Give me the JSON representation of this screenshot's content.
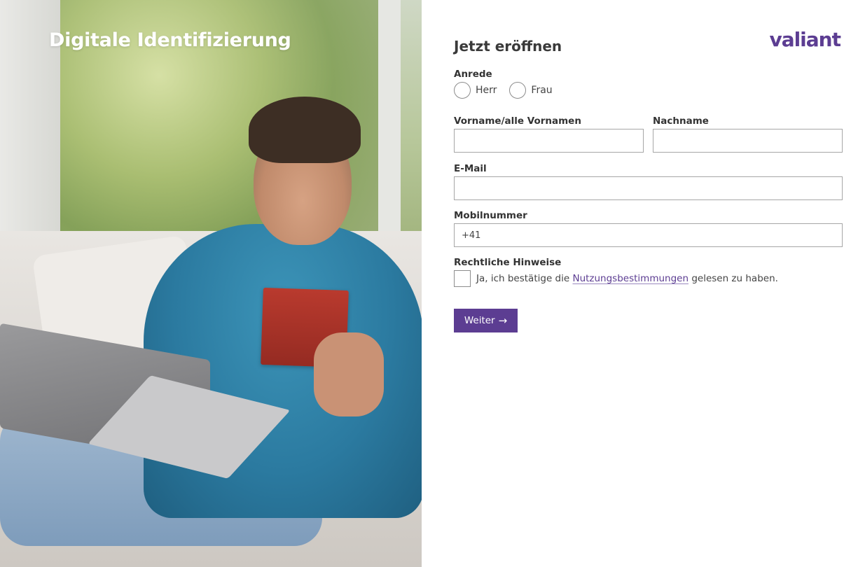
{
  "hero": {
    "title": "Digitale Identifizierung"
  },
  "brand": {
    "logo_text": "valiant",
    "accent_color": "#5c3d92"
  },
  "form": {
    "title": "Jetzt eröffnen",
    "salutation": {
      "label": "Anrede",
      "options": [
        "Herr",
        "Frau"
      ]
    },
    "first_name": {
      "label": "Vorname/alle Vornamen",
      "value": ""
    },
    "last_name": {
      "label": "Nachname",
      "value": ""
    },
    "email": {
      "label": "E-Mail",
      "value": ""
    },
    "mobile": {
      "label": "Mobilnummer",
      "value": "+41"
    },
    "legal": {
      "label": "Rechtliche Hinweise",
      "text_before": "Ja, ich bestätige die",
      "link_text": "Nutzungsbestimmungen",
      "text_after": "gelesen zu haben."
    },
    "submit_label": "Weiter",
    "submit_icon": "arrow-right-icon"
  }
}
